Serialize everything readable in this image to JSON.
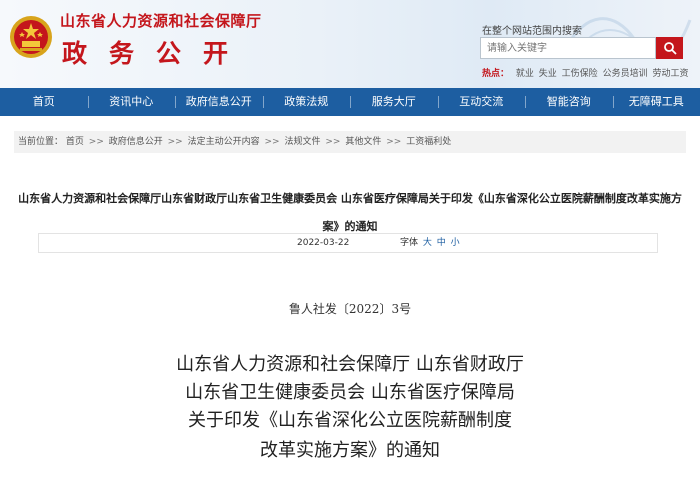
{
  "header": {
    "site_name": "山东省人力资源和社会保障厅",
    "site_sub": "政务公开",
    "emblem_icon": "national-emblem-icon",
    "brand_color": "#c4161c",
    "search": {
      "caption": "在整个网站范围内搜索",
      "placeholder": "请输入关键字",
      "button_icon": "search-icon"
    },
    "hot": {
      "label": "热点：",
      "keywords": [
        "就业",
        "失业",
        "工伤保险",
        "公务员培训",
        "劳动工资"
      ]
    }
  },
  "nav": {
    "bg_color": "#1d5ea1",
    "items": [
      "首页",
      "资讯中心",
      "政府信息公开",
      "政策法规",
      "服务大厅",
      "互动交流",
      "智能咨询",
      "无障碍工具"
    ]
  },
  "breadcrumb": {
    "prefix": "当前位置：",
    "items": [
      "首页",
      "政府信息公开",
      "法定主动公开内容",
      "法规文件",
      "其他文件",
      "工资福利处"
    ],
    "separator": ">>"
  },
  "article": {
    "title": "山东省人力资源和社会保障厅山东省财政厅山东省卫生健康委员会 山东省医疗保障局关于印发《山东省深化公立医院薪酬制度改革实施方案》的通知",
    "date": "2022-03-22",
    "font_label": "字体",
    "font_sizes": [
      "大",
      "中",
      "小"
    ],
    "doc_no": "鲁人社发〔2022〕3号",
    "body_title_lines": [
      "山东省人力资源和社会保障厅 山东省财政厅",
      "山东省卫生健康委员会 山东省医疗保障局",
      "关于印发《山东省深化公立医院薪酬制度",
      "改革实施方案》的通知"
    ]
  }
}
